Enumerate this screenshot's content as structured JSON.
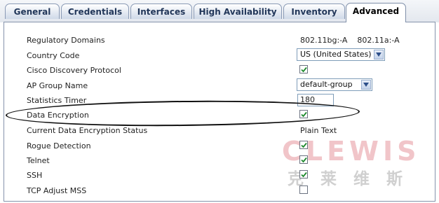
{
  "tabs": [
    {
      "label": "General",
      "active": false
    },
    {
      "label": "Credentials",
      "active": false
    },
    {
      "label": "Interfaces",
      "active": false
    },
    {
      "label": "High Availability",
      "active": false
    },
    {
      "label": "Inventory",
      "active": false
    },
    {
      "label": "Advanced",
      "active": true
    }
  ],
  "fields": {
    "regulatory_domains": {
      "label": "Regulatory Domains",
      "value": "802.11bg:-A    802.11a:-A"
    },
    "country_code": {
      "label": "Country Code",
      "value": "US (United States)"
    },
    "cdp": {
      "label": "Cisco Discovery Protocol",
      "checked": true
    },
    "ap_group": {
      "label": "AP Group Name",
      "value": "default-group"
    },
    "stats_timer": {
      "label": "Statistics Timer",
      "value": "180"
    },
    "data_encryption": {
      "label": "Data Encryption",
      "checked": true
    },
    "current_encryption": {
      "label": "Current Data Encryption Status",
      "value": "Plain Text"
    },
    "rogue_detection": {
      "label": "Rogue Detection",
      "checked": true
    },
    "telnet": {
      "label": "Telnet",
      "checked": true
    },
    "ssh": {
      "label": "SSH",
      "checked": true
    },
    "tcp_adjust_mss": {
      "label": "TCP Adjust MSS",
      "checked": false
    }
  },
  "watermark": {
    "latin": "CLEWIS",
    "cjk": "克莱维斯"
  },
  "icons": {
    "checkmark": "checkmark-icon",
    "dropdown": "chevron-down-icon"
  },
  "colors": {
    "tab_text": "#22375a",
    "border": "#8593ab",
    "check": "#1e8a2e"
  }
}
